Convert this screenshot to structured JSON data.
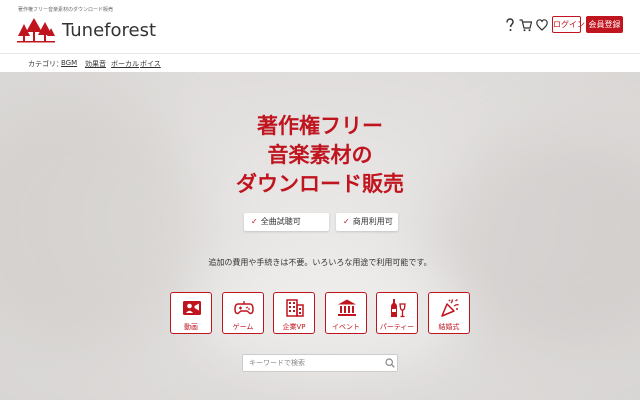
{
  "header": {
    "tagline": "著作権フリー音楽素材のダウンロード販売",
    "brand": "Tuneforest",
    "login_label": "ログイン",
    "signup_label": "会員登録",
    "icons": [
      "help-icon",
      "cart-icon",
      "heart-icon"
    ]
  },
  "nav": {
    "label": "カテゴリ：",
    "items": [
      "BGM",
      "効果音",
      "ボーカル",
      "ボイス"
    ]
  },
  "hero": {
    "headline": [
      "著作権フリー",
      "音楽素材の",
      "ダウンロード販売"
    ],
    "badges": [
      "全曲試聴可",
      "商用利用可"
    ],
    "subtext": "追加の費用や手続きは不要。いろいろな用途で利用可能です。",
    "categories": [
      {
        "label": "動画",
        "icon": "video-camera-icon"
      },
      {
        "label": "ゲーム",
        "icon": "gamepad-icon"
      },
      {
        "label": "企業VP",
        "icon": "building-icon"
      },
      {
        "label": "イベント",
        "icon": "venue-icon"
      },
      {
        "label": "パーティー",
        "icon": "party-bottles-icon"
      },
      {
        "label": "結婚式",
        "icon": "celebration-icon"
      }
    ]
  },
  "search": {
    "placeholder": "キーワードで検索"
  },
  "colors": {
    "accent": "#c0141f",
    "text": "#333333"
  }
}
